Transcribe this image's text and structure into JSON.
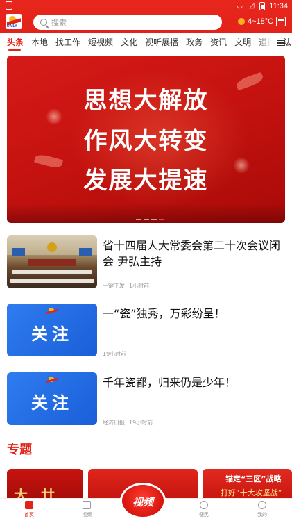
{
  "status_bar": {
    "time": "11:34"
  },
  "header": {
    "logo_text": "DAILY",
    "search_placeholder": "搜索",
    "weather": "4~18°C"
  },
  "tabs": [
    "头条",
    "本地",
    "找工作",
    "短视频",
    "文化",
    "视听展播",
    "政务",
    "资讯",
    "文明",
    "道德",
    "法"
  ],
  "banner": {
    "lines": [
      "思想大解放",
      "作风大转变",
      "发展大提速"
    ]
  },
  "news": [
    {
      "title": "省十四届人大常委会第二十次会议闭会 尹弘主持",
      "source": "一键下发",
      "time": "1小时前"
    },
    {
      "title": "一“瓷”独秀，万彩纷呈！",
      "source": "",
      "time": "19小时前",
      "thumb_text": "关注"
    },
    {
      "title": "千年瓷都，归来仍是少年！",
      "source": "经济日报",
      "time": "19小时前",
      "thumb_text": "关注"
    }
  ],
  "section": {
    "title": "专题"
  },
  "topics": [
    {
      "text": "大 廿 不"
    },
    {
      "text": ""
    },
    {
      "line1": "锚定“三区”战略",
      "line2": "打好“十大攻坚战”"
    }
  ],
  "bottom_nav": {
    "home": "首页",
    "video": "视频",
    "center": "视频",
    "service": "便民",
    "mine": "我的"
  }
}
